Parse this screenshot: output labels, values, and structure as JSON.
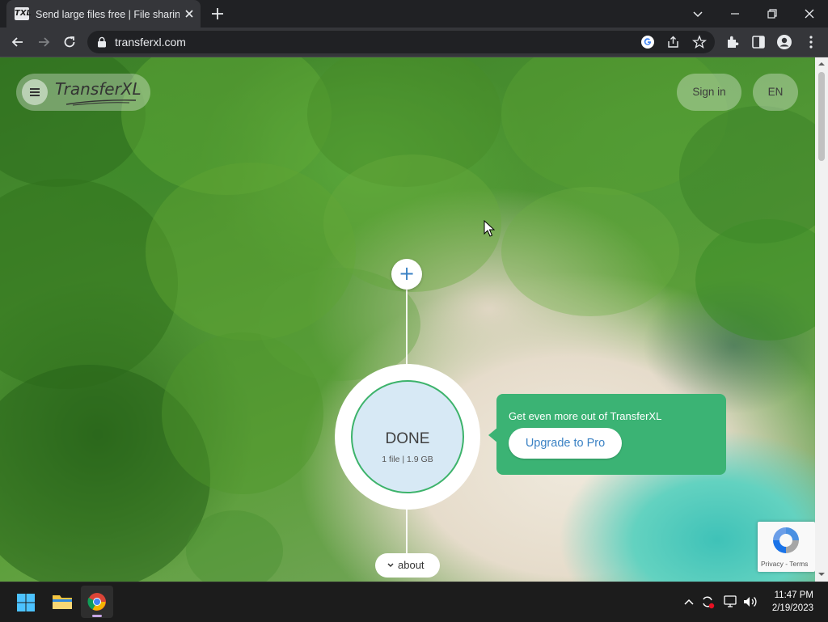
{
  "browser": {
    "tab": {
      "favicon_text": "TXL",
      "title": "Send large files free | File sharing"
    },
    "address": "transferxl.com"
  },
  "page": {
    "logo_text": "TransferXL",
    "sign_in_label": "Sign in",
    "language_label": "EN",
    "uploader": {
      "status": "DONE",
      "summary": "1 file | 1.9 GB"
    },
    "callout": {
      "title": "Get even more out of TransferXL",
      "upgrade_label": "Upgrade to Pro"
    },
    "about_label": "about",
    "recaptcha_links": "Privacy - Terms"
  },
  "taskbar": {
    "time": "11:47 PM",
    "date": "2/19/2023"
  },
  "colors": {
    "accent_green": "#3bb374",
    "accent_blue": "#3b82c4",
    "chrome_dark": "#202124",
    "chrome_toolbar": "#35363a"
  }
}
